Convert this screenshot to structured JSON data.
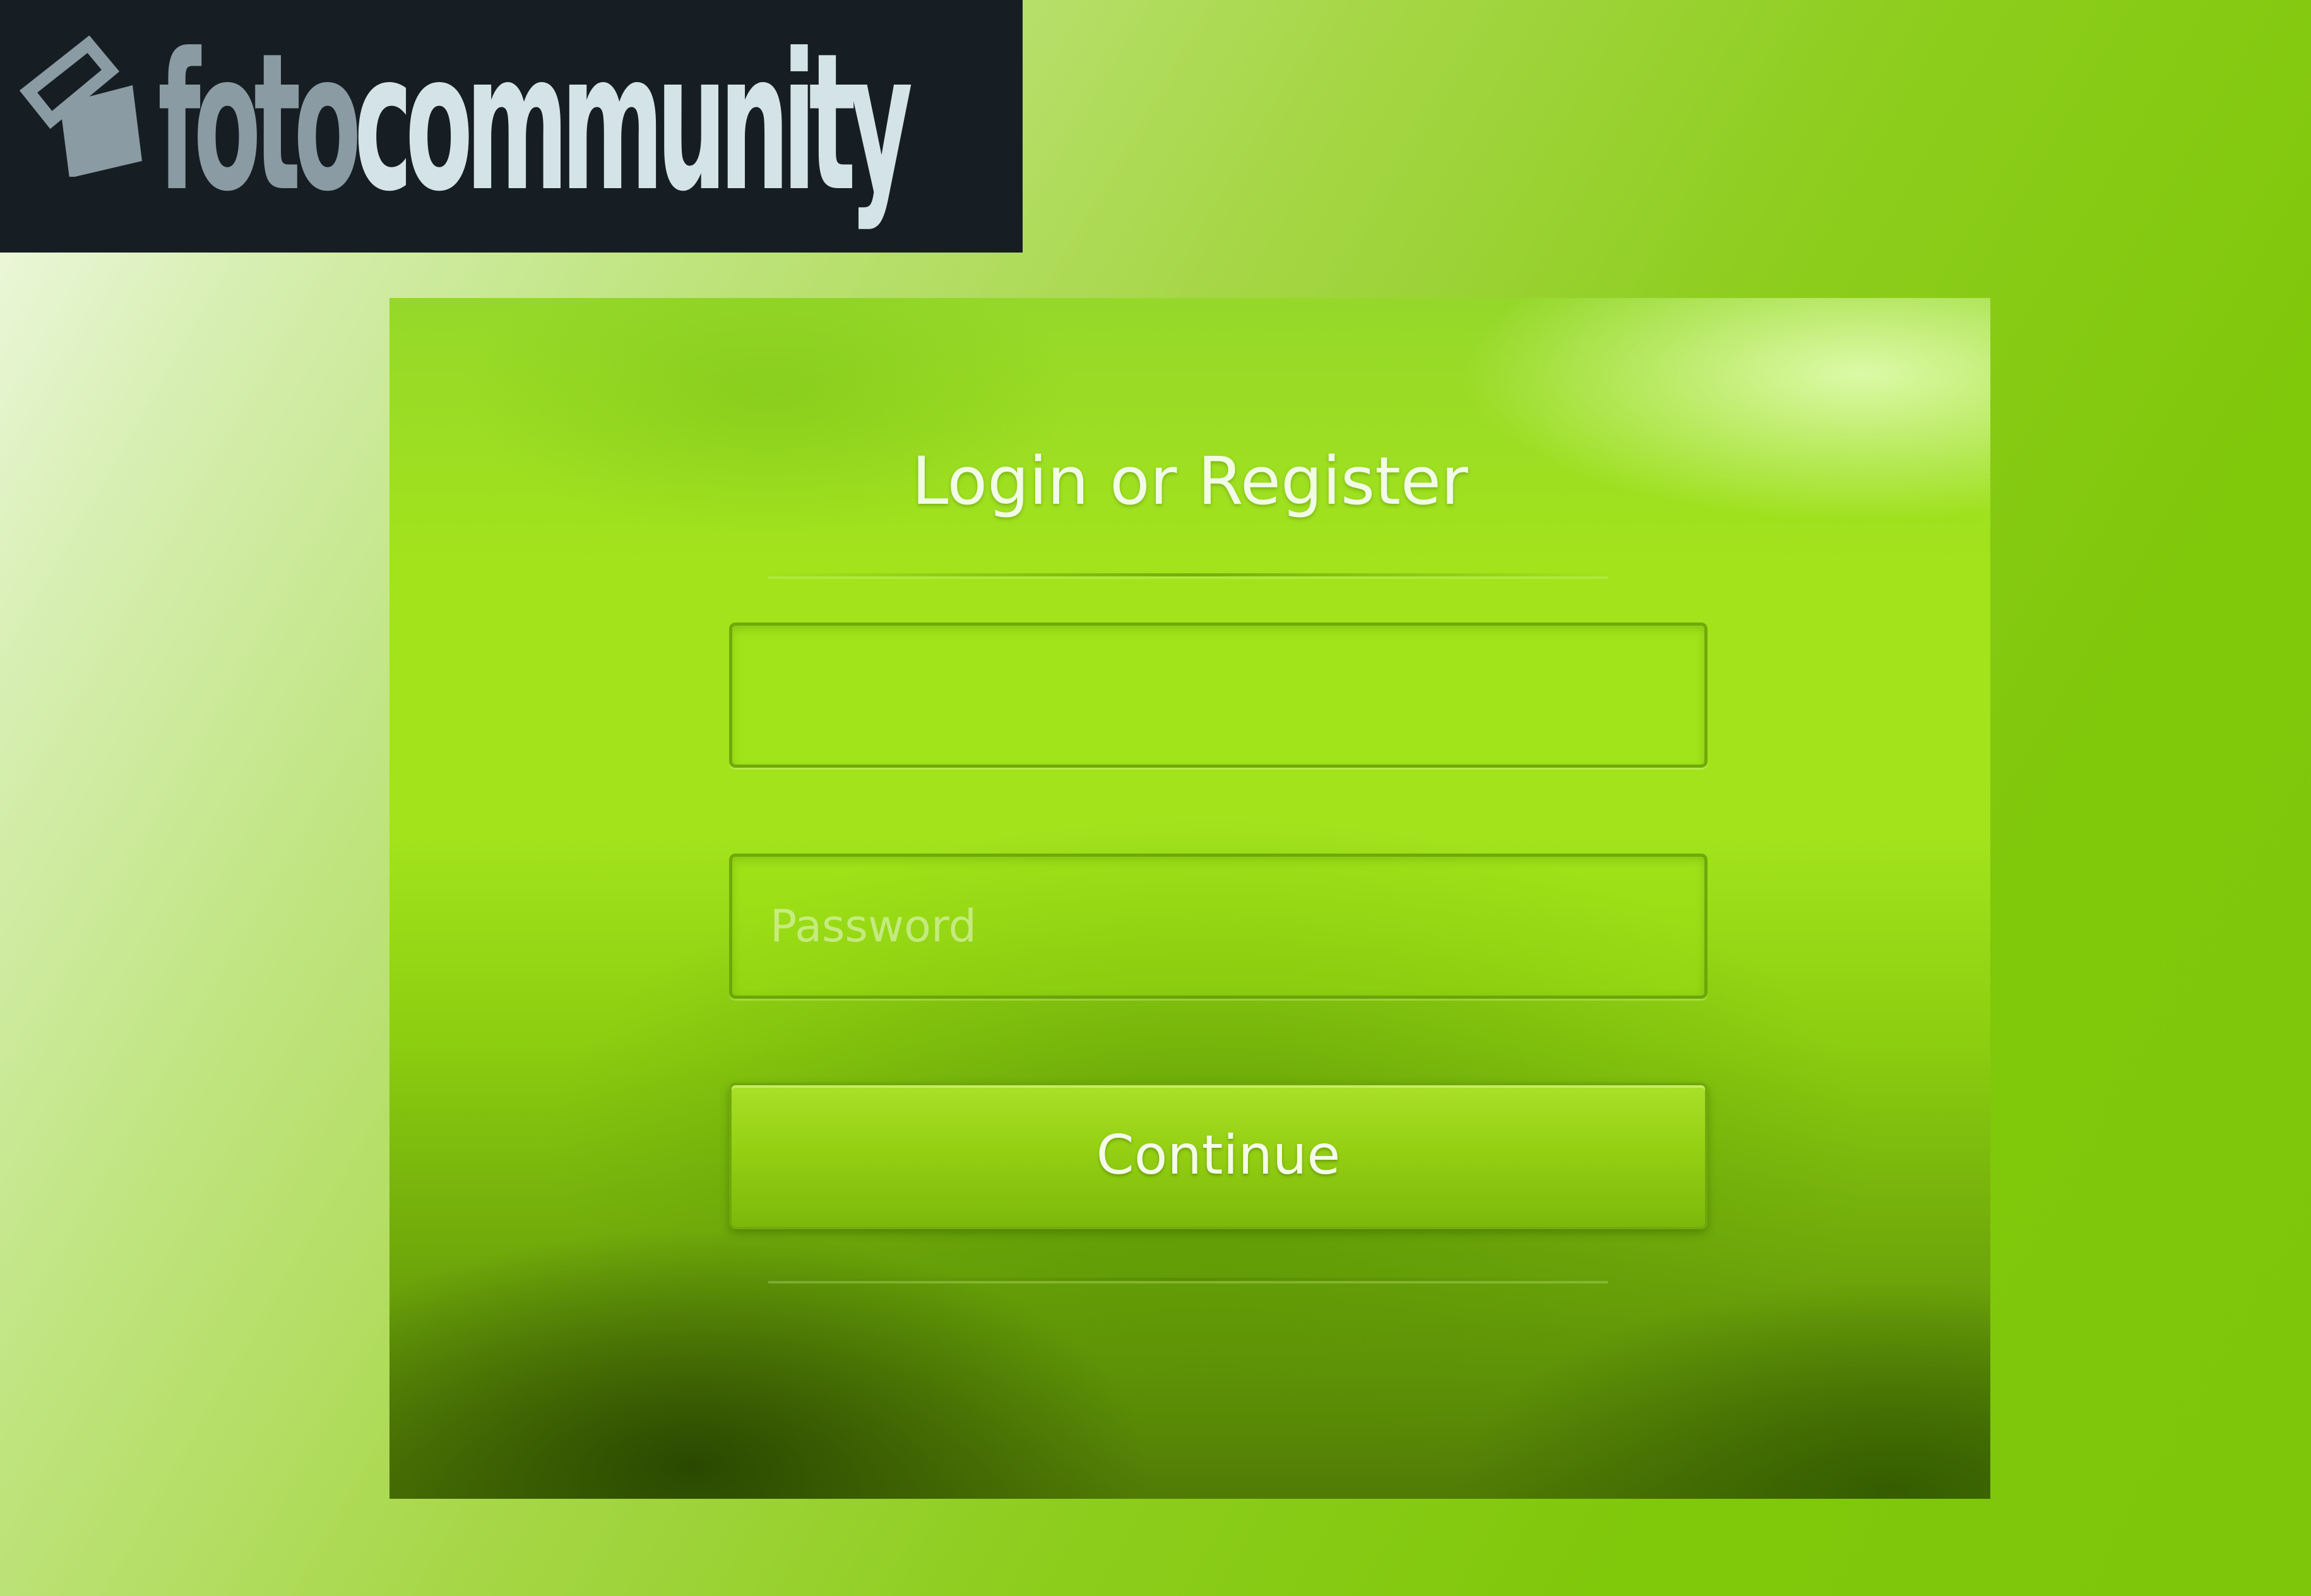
{
  "logo": {
    "part1": "foto",
    "part2": "community",
    "icon": "photo-frame-icon"
  },
  "login": {
    "title": "Login or Register",
    "username_placeholder": "",
    "password_placeholder": "Password",
    "continue_label": "Continue"
  },
  "colors": {
    "banner_background": "#161e23",
    "logo_foto": "#8a9ba3",
    "logo_community": "#d4e3e8",
    "panel_green": "#a2e31c",
    "text_light": "#f1fbe5"
  }
}
